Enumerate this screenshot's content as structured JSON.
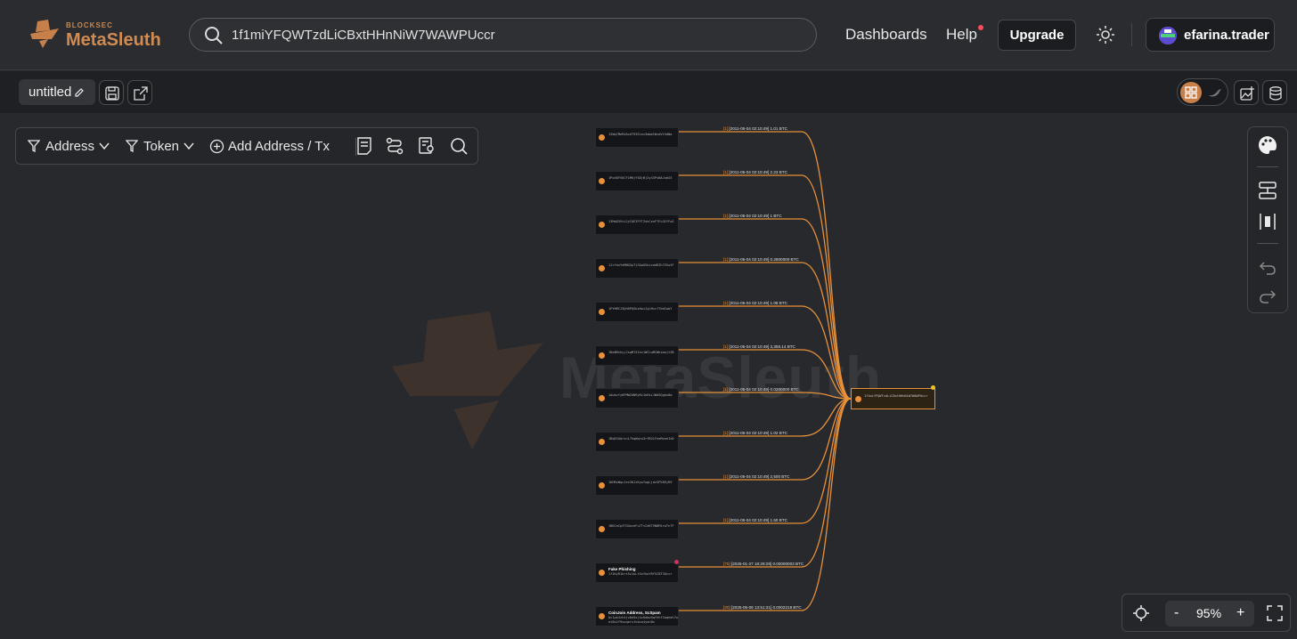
{
  "brand": {
    "sub": "BLOCKSEC",
    "name": "MetaSleuth"
  },
  "search": {
    "value": "1f1miYFQWTzdLiCBxtHHnNiW7WAWPUccr"
  },
  "nav": {
    "dashboards": "Dashboards",
    "help": "Help",
    "upgrade": "Upgrade"
  },
  "user": {
    "name": "efarina.trader"
  },
  "tab": {
    "name": "untitled"
  },
  "toolbar": {
    "address": "Address",
    "token": "Token",
    "add": "Add Address / Tx"
  },
  "zoom": {
    "value": "95%",
    "minus": "-",
    "plus": "+"
  },
  "watermark": "MetaSleuth",
  "colors": {
    "accent": "#e8903a",
    "edge": "#e8903a",
    "background": "#27292d"
  },
  "graph": {
    "target": {
      "address": "1f1miYFQWTzdLiCBxtHHnNiW7WAWPUccr"
    },
    "sources": [
      {
        "address": "12Wq7MeR4AxdT93Eiev3mbmCWvdVt3dNa",
        "edge": "[2011-05-04 02:10:49] 1.01 BTC",
        "count": "[1]"
      },
      {
        "address": "1PoX6FVUCFLMKjYSDjBj2yX3PsNAJxbS5",
        "edge": "[2011-05-04 02:10:49] 2.23 BTC",
        "count": "[1]"
      },
      {
        "address": "13MoD3VtiJyCUE3FYTZxhCenF7Fu3IfFwS",
        "edge": "[2011-05-04 02:10:49] 1 BTC",
        "count": "[1]"
      },
      {
        "address": "1JcfanYeMNGGpTjSAaGVkzzodRZh7VSwtF",
        "edge": "[2011-05-04 02:10:49] 0.2800000 BTC",
        "count": "[1]"
      },
      {
        "address": "1PYHMCJ3QhRPQSksHwiJyLMccfTddCwbY",
        "edge": "[2011-05-04 02:10:49] 1.08 BTC",
        "count": "[1]"
      },
      {
        "address": "1Be8MvhyjJsqMT4Iev1WCLwMCWkimejtZB",
        "edge": "[2011-05-04 02:10:49] 3,358.14 BTC",
        "count": "[1]"
      },
      {
        "address": "1AwkzfyHFMWZdN9yRz1kHsLJWd5Qgbx8m",
        "edge": "[2011-05-04 02:10:49] 0.0200000 BTC",
        "count": "[1]"
      },
      {
        "address": "1BqEXAArsnL7hqWqrw3rfB2LFeeMzeeIxD",
        "edge": "[2011-05-04 02:10:49] 1.02 BTC",
        "count": "[1]"
      },
      {
        "address": "1KHRxWqcJes3KJzKyw7wgLjdzSPX89jR9",
        "edge": "[2011-05-04 02:10:49] 2,500 BTC",
        "count": "[1]"
      },
      {
        "address": "1BDCaCp37GUozeFu7TvCd6T5N8M1rwTn7F",
        "edge": "[2011-05-04 02:10:49] 1.50 BTC",
        "count": "[1]"
      },
      {
        "label": "Fake Phishing",
        "address": "1f1KyR1krt5x1uLfXxYkoYRfSCBT3Uccr",
        "edge": "[2025-01-27 18:29:28] 0.00000003 BTC",
        "count": "[75]",
        "tagged": true
      },
      {
        "label": "CoinJoin Address, ScSpam",
        "address": "bc1pk4zh4jvbe5ojkz6abwhqfhhf2aqheh7wet8s2f9ssqerufnbzo4yen8n",
        "edge": "[2025-05-08 13:51:31] 0.0002218 BTC",
        "count": "[30]"
      }
    ]
  }
}
